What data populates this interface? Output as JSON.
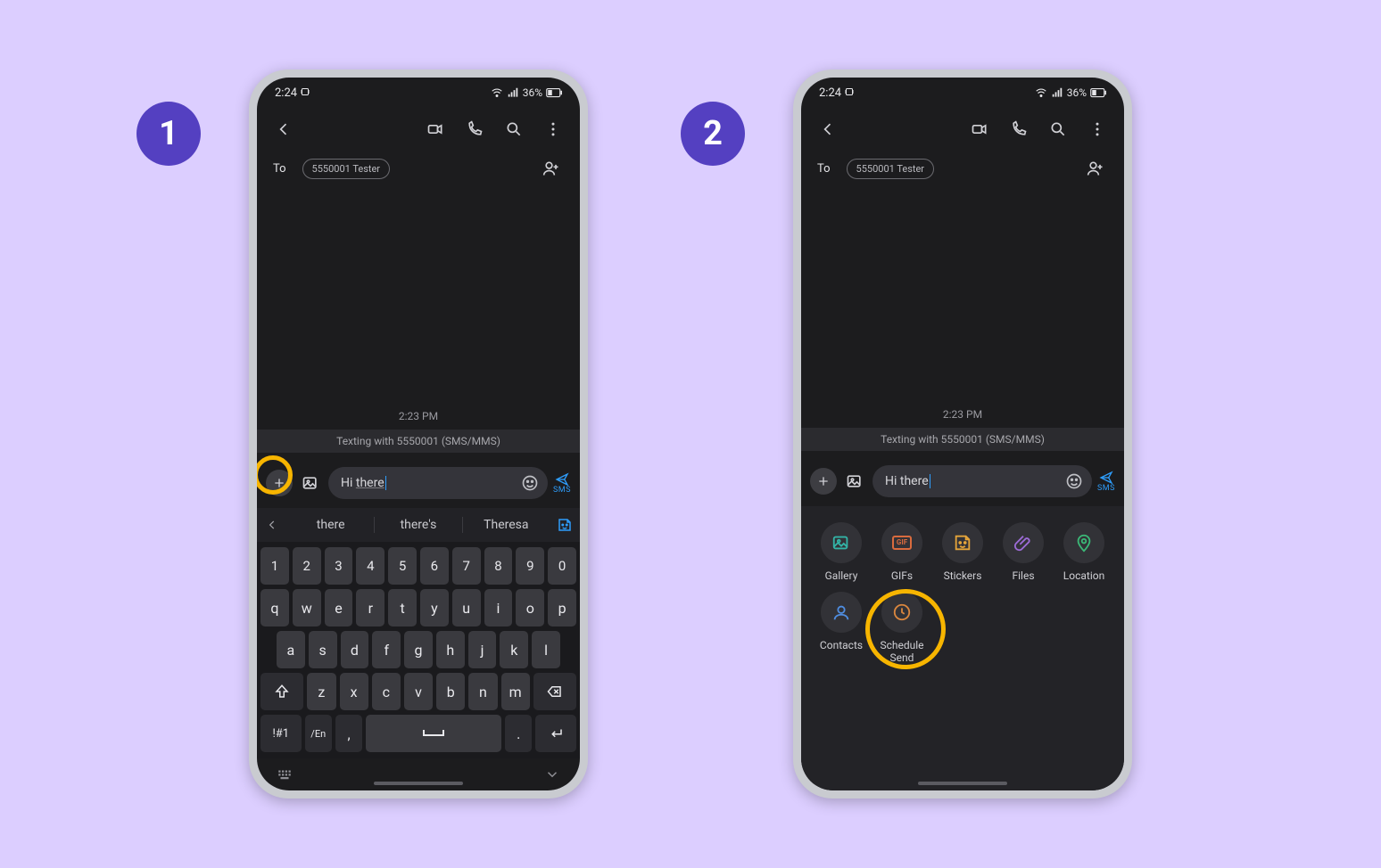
{
  "steps": {
    "one": "1",
    "two": "2"
  },
  "status": {
    "time": "2:24",
    "battery_pct": "36%"
  },
  "recipient": {
    "to_label": "To",
    "chip": "5550001 Tester"
  },
  "conversation": {
    "time": "2:23 PM",
    "banner": "Texting with 5550001 (SMS/MMS)"
  },
  "compose": {
    "text_prefix": "Hi ",
    "text_underlined": "there",
    "send_label": "SMS"
  },
  "suggestions": {
    "s1": "there",
    "s2": "there's",
    "s3": "Theresa"
  },
  "keyboard": {
    "row_num": [
      "1",
      "2",
      "3",
      "4",
      "5",
      "6",
      "7",
      "8",
      "9",
      "0"
    ],
    "row_q": [
      "q",
      "w",
      "e",
      "r",
      "t",
      "y",
      "u",
      "i",
      "o",
      "p"
    ],
    "row_a": [
      "a",
      "s",
      "d",
      "f",
      "g",
      "h",
      "j",
      "k",
      "l"
    ],
    "row_z": [
      "z",
      "x",
      "c",
      "v",
      "b",
      "n",
      "m"
    ],
    "sym_key": "!#1",
    "lang_key": "/En",
    "comma": ",",
    "period": "."
  },
  "attachments": {
    "gallery": "Gallery",
    "gifs": "GIFs",
    "gif_badge": "GIF",
    "stickers": "Stickers",
    "files": "Files",
    "location": "Location",
    "contacts": "Contacts",
    "schedule": "Schedule Send"
  }
}
